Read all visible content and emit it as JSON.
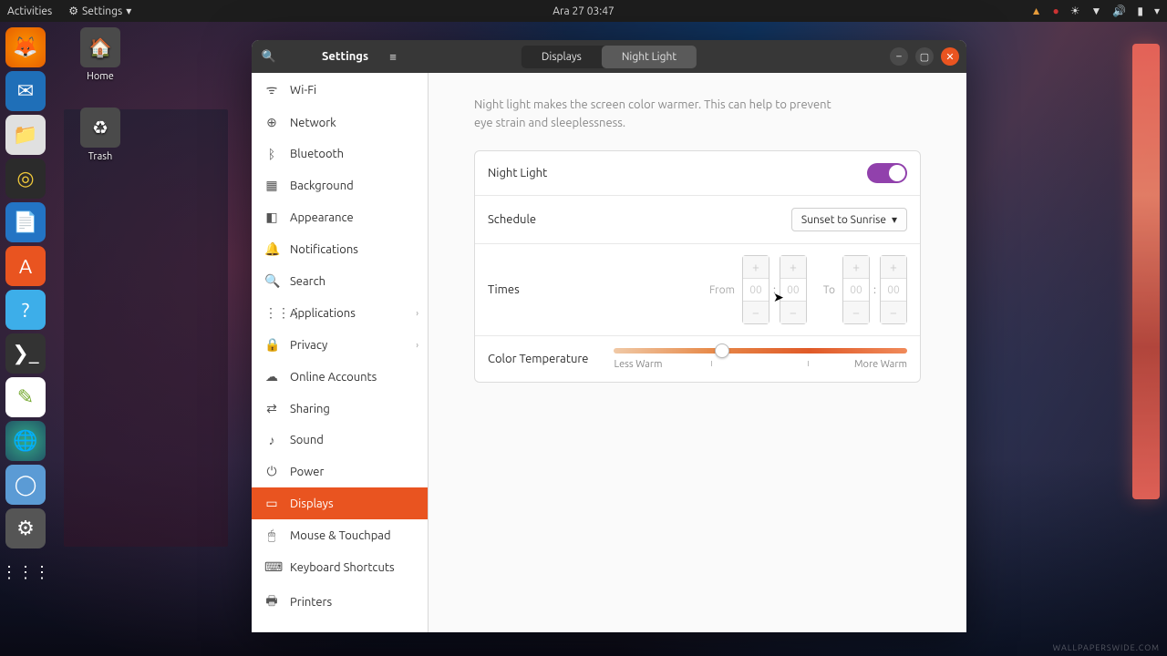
{
  "topbar": {
    "activities": "Activities",
    "app": "Settings",
    "clock": "Ara 27  03:47"
  },
  "desktop": {
    "home": "Home",
    "trash": "Trash"
  },
  "window": {
    "title": "Settings",
    "tabs": {
      "displays": "Displays",
      "nightlight": "Night Light"
    },
    "sidebar": [
      {
        "icon": "wifi",
        "label": "Wi-Fi"
      },
      {
        "icon": "net",
        "label": "Network"
      },
      {
        "icon": "bt",
        "label": "Bluetooth"
      },
      {
        "icon": "bg",
        "label": "Background"
      },
      {
        "icon": "appr",
        "label": "Appearance"
      },
      {
        "icon": "notif",
        "label": "Notifications"
      },
      {
        "icon": "search",
        "label": "Search"
      },
      {
        "icon": "apps",
        "label": "Applications",
        "sub": true
      },
      {
        "icon": "priv",
        "label": "Privacy",
        "sub": true
      },
      {
        "icon": "online",
        "label": "Online Accounts"
      },
      {
        "icon": "share",
        "label": "Sharing"
      },
      {
        "icon": "sound",
        "label": "Sound"
      },
      {
        "icon": "power",
        "label": "Power"
      },
      {
        "icon": "disp",
        "label": "Displays",
        "active": true
      },
      {
        "icon": "mouse",
        "label": "Mouse & Touchpad"
      },
      {
        "icon": "kbd",
        "label": "Keyboard Shortcuts"
      },
      {
        "icon": "print",
        "label": "Printers"
      }
    ],
    "content": {
      "description": "Night light makes the screen color warmer. This can help to prevent eye strain and sleeplessness.",
      "nightlight_label": "Night Light",
      "schedule_label": "Schedule",
      "schedule_value": "Sunset to Sunrise",
      "times_label": "Times",
      "from_label": "From",
      "to_label": "To",
      "from_h": "00",
      "from_m": "00",
      "to_h": "00",
      "to_m": "00",
      "colortemp_label": "Color Temperature",
      "less_warm": "Less Warm",
      "more_warm": "More Warm"
    }
  },
  "wp_credit": "WALLPAPERSWIDE.COM"
}
